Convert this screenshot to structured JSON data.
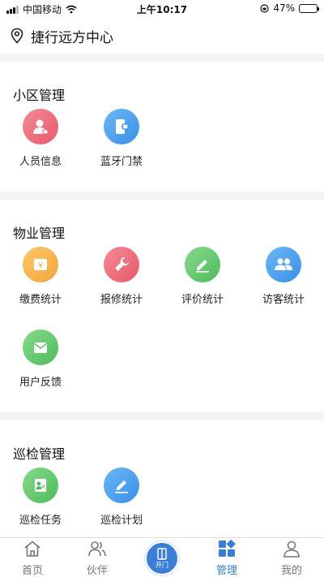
{
  "status_bar": {
    "carrier": "中国移动",
    "time": "上午10:17",
    "battery": "47%",
    "battery_level": 0.47
  },
  "header": {
    "location": "捷行远方中心"
  },
  "sections": [
    {
      "title": "小区管理",
      "items": [
        {
          "label": "人员信息",
          "icon": "person-info-icon",
          "color": "red"
        },
        {
          "label": "蓝牙门禁",
          "icon": "bluetooth-door-icon",
          "color": "blue"
        }
      ]
    },
    {
      "title": "物业管理",
      "items": [
        {
          "label": "缴费统计",
          "icon": "payment-icon",
          "color": "orange"
        },
        {
          "label": "报修统计",
          "icon": "wrench-icon",
          "color": "red"
        },
        {
          "label": "评价统计",
          "icon": "review-edit-icon",
          "color": "green"
        },
        {
          "label": "访客统计",
          "icon": "visitors-icon",
          "color": "blue"
        },
        {
          "label": "用户反馈",
          "icon": "feedback-mail-icon",
          "color": "green"
        }
      ]
    },
    {
      "title": "巡检管理",
      "items": [
        {
          "label": "巡检任务",
          "icon": "inspection-task-icon",
          "color": "green"
        },
        {
          "label": "巡检计划",
          "icon": "inspection-plan-icon",
          "color": "blue"
        }
      ]
    }
  ],
  "tabbar": {
    "home": "首页",
    "partner": "伙伴",
    "door": "开门",
    "manage": "管理",
    "mine": "我的",
    "active": "管理"
  },
  "colors": {
    "accent": "#3a7fd6",
    "red": "#e55a6b",
    "blue": "#3a8ee6",
    "orange": "#f2a43a",
    "green": "#4dbb5c"
  }
}
